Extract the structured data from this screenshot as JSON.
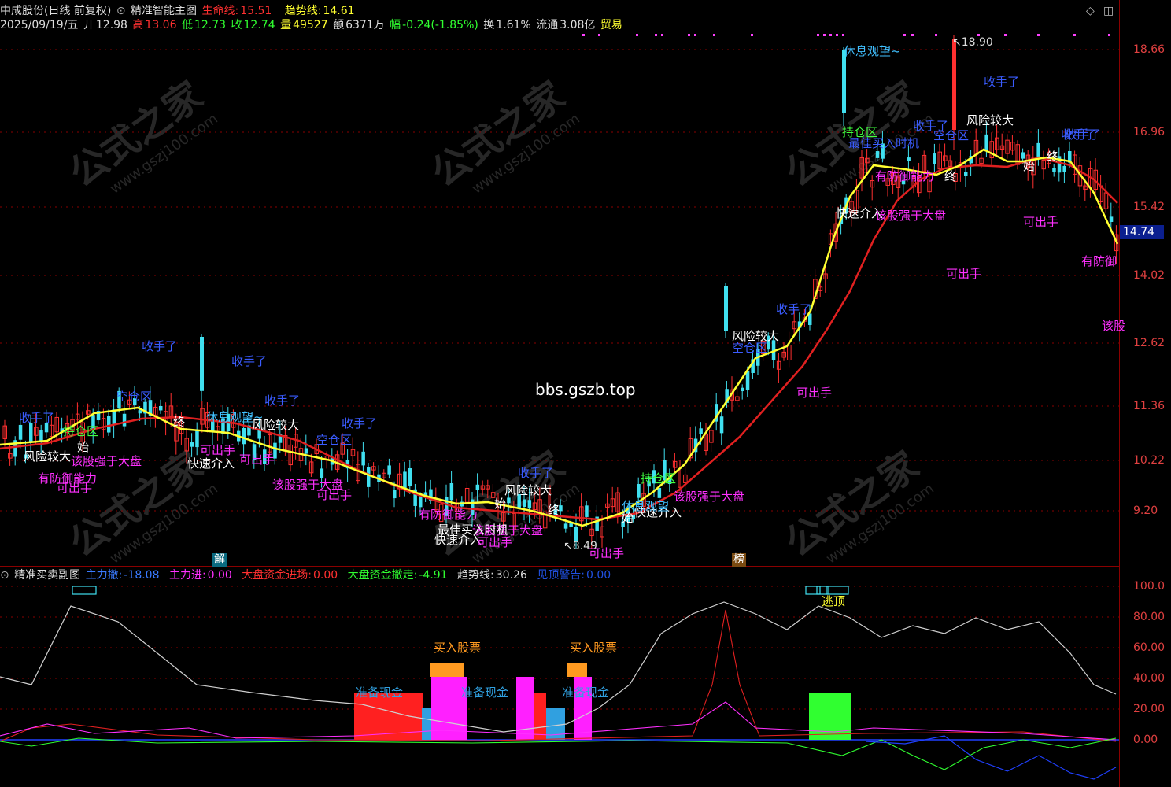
{
  "main_header": {
    "stock_name": "中成股份(日线 前复权)",
    "indicator_name": "精准智能主图",
    "life_line_label": "生命线:",
    "life_line_value": "15.51",
    "trend_line_label": "趋势线:",
    "trend_line_value": "14.61"
  },
  "quote": {
    "date": "2025/09/19/五",
    "open_label": "开",
    "open": "12.98",
    "high_label": "高",
    "high": "13.06",
    "low_label": "低",
    "low": "12.73",
    "close_label": "收",
    "close": "12.74",
    "volume_label": "量",
    "volume": "49527",
    "amount_label": "额",
    "amount": "6371万",
    "change_label": "幅",
    "change": "-0.24(-1.85%)",
    "turnover_label": "换",
    "turnover": "1.61%",
    "float_label": "流通",
    "float_cap": "3.08亿",
    "sector": "贸易"
  },
  "price_axis": [
    "18.66",
    "16.96",
    "15.42",
    "14.02",
    "12.62",
    "11.36",
    "10.22",
    "9.20"
  ],
  "current_price_tag": "14.74",
  "extremes": {
    "high_marker": "18.90",
    "low_marker": "8.49"
  },
  "watermark_center": "bbs.gszb.top",
  "watermark_brand": "公式之家",
  "watermark_url": "www.gszj100.com",
  "bottom_markers": {
    "jie": "解",
    "bang": "榜"
  },
  "sub_header": {
    "indicator_name": "精准买卖副图",
    "main_out_label": "主力撤:",
    "main_out_value": "-18.08",
    "main_in_label": "主力进:",
    "main_in_value": "0.00",
    "market_in_label": "大盘资金进场:",
    "market_in_value": "0.00",
    "market_out_label": "大盘资金撤走:",
    "market_out_value": "-4.91",
    "trend_label": "趋势线:",
    "trend_value": "30.26",
    "top_warn_label": "见顶警告:",
    "top_warn_value": "0.00"
  },
  "sub_axis": [
    "100.0",
    "80.00",
    "60.00",
    "40.00",
    "20.00",
    "0.00"
  ],
  "sub_annotations": {
    "buy1": "买入股票",
    "buy2": "买入股票",
    "cash1": "准备现金",
    "cash2": "准备现金",
    "cash3": "准备现金",
    "escape": "逃顶"
  },
  "annotations": {
    "a01": "收手了",
    "a02": "收手了",
    "a03": "收手了",
    "a04": "收手了",
    "a05": "收手了",
    "a06": "空仓区",
    "a07": "持仓区",
    "a08": "风险较大",
    "a09": "该股强于大盘",
    "a10": "有防御能力",
    "a11": "可出手",
    "a12": "终",
    "a13": "快速介入",
    "a14": "可出手",
    "a15": "休息观望~",
    "a16": "风险较大",
    "a17": "可出手",
    "a18": "空仓区",
    "a19": "该股强于大盘",
    "a20": "可出手",
    "a21": "收手了",
    "a22": "风险较大",
    "a23": "该股强于大盘",
    "a24": "快速介入",
    "a25": "最佳买入时机",
    "a26": "有防御能力",
    "a27": "终",
    "a28": "持仓区",
    "a29": "该股强于大盘",
    "a30": "快速介入",
    "a31": "休息观望",
    "a32": "风险较大",
    "a33": "空仓区",
    "a34": "可出手",
    "a35": "收手了",
    "a36": "休息观望~",
    "a37": "持仓区",
    "a38": "最佳买入时机",
    "a39": "有防御能力",
    "a40": "快速介入",
    "a41": "该股强于大盘",
    "a42": "收手了",
    "a43": "空仓区",
    "a44": "风险较大",
    "a45": "收手了",
    "a46": "收手了",
    "a47": "可出手",
    "a48": "可出手",
    "a49": "有防御",
    "a50": "该股",
    "a51": "始",
    "a52": "始",
    "a53": "始",
    "a54": "终",
    "a55": "始",
    "a56": "终",
    "a57": "可出手",
    "a58": "收手了",
    "a59": "可出手"
  },
  "colors": {
    "candle_up": "#ff3030",
    "candle_down": "#40e0f0",
    "trend_line": "#ffff30",
    "life_line": "#e02020",
    "grid": "#8a0000",
    "axis_text": "#e04040",
    "annot_blue": "#3a5cff",
    "annot_magenta": "#ff30ff",
    "annot_white": "#ffffff",
    "annot_green": "#40ff40",
    "annot_cyan": "#40c0ff",
    "purple_dots": "#ff40ff"
  }
}
